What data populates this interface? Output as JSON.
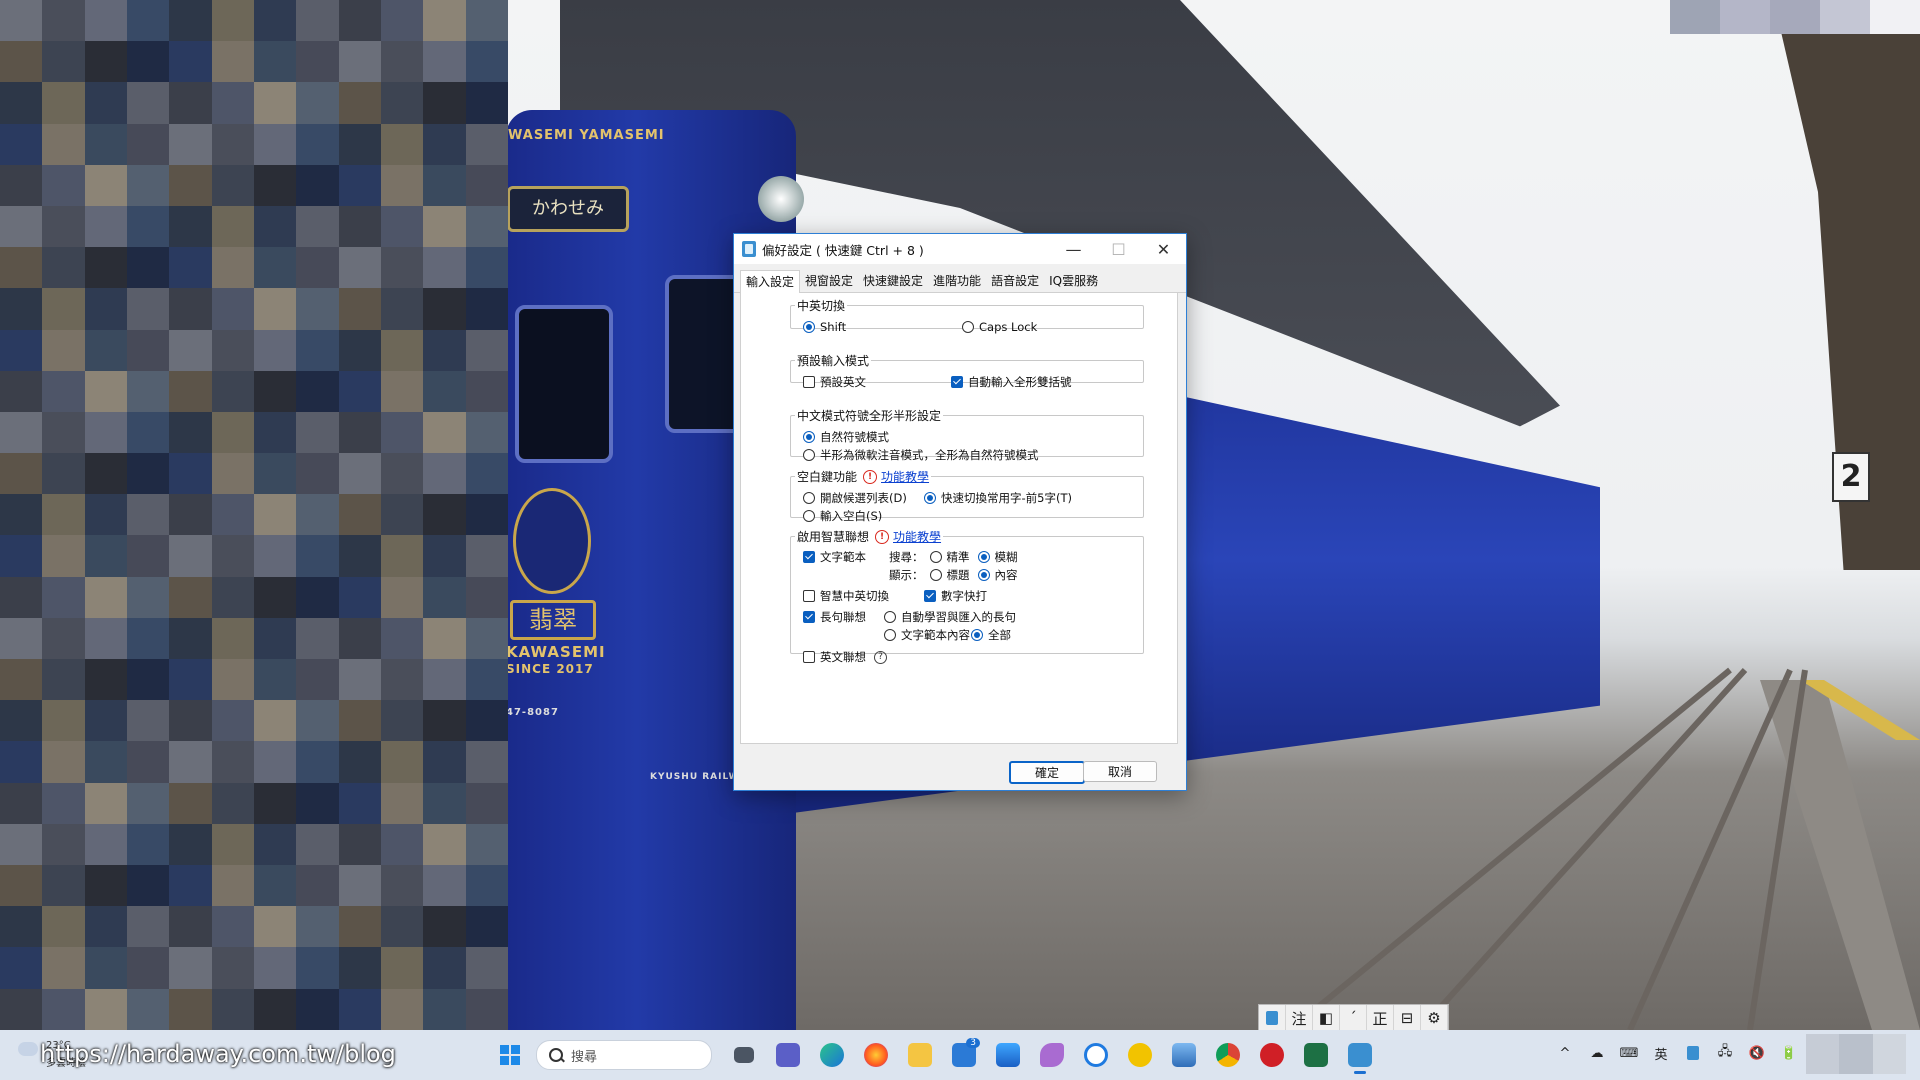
{
  "watermark": "https://hardaway.com.tw/blog",
  "wallpaper": {
    "destination_sign": "かわせみ",
    "train_name": "KAWASEMI",
    "train_name_cn": "翡翠",
    "since": "SINCE 2017",
    "car_number": "47-8087",
    "railway": "KYUSHU RAILWAY",
    "headboard": "WASEMI YAMASEMI",
    "platform_number": "2"
  },
  "dialog": {
    "title": "偏好設定 ( 快速鍵 Ctrl + 8 )",
    "controls": {
      "minimize": "—",
      "maximize": "☐",
      "close": "✕"
    },
    "tabs": [
      {
        "label": "輸入設定",
        "active": true
      },
      {
        "label": "視窗設定",
        "active": false
      },
      {
        "label": "快速鍵設定",
        "active": false
      },
      {
        "label": "進階功能",
        "active": false
      },
      {
        "label": "語音設定",
        "active": false
      },
      {
        "label": "IQ雲服務",
        "active": false
      }
    ],
    "groups": {
      "switch": {
        "legend": "中英切換",
        "options": [
          {
            "label": "Shift",
            "selected": true
          },
          {
            "label": "Caps Lock",
            "selected": false
          }
        ]
      },
      "default_mode": {
        "legend": "預設輸入模式",
        "options": [
          {
            "label": "預設英文",
            "checked": false
          },
          {
            "label": "自動輸入全形雙括號",
            "checked": true
          }
        ]
      },
      "symbol": {
        "legend": "中文模式符號全形半形設定",
        "options": [
          {
            "label": "自然符號模式",
            "selected": true
          },
          {
            "label": "半形為微軟注音模式，全形為自然符號模式",
            "selected": false
          }
        ]
      },
      "space": {
        "legend": "空白鍵功能",
        "link": "功能教學",
        "options": [
          {
            "label": "開啟候選列表(D)",
            "selected": false
          },
          {
            "label": "快速切換常用字-前5字(T)",
            "selected": true
          },
          {
            "label": "輸入空白(S)",
            "selected": false
          }
        ]
      },
      "smart": {
        "legend": "啟用智慧聯想",
        "link": "功能教學",
        "text_template": {
          "label": "文字範本",
          "checked": true
        },
        "search_label": "搜尋：",
        "search_options": [
          {
            "label": "精準",
            "selected": false
          },
          {
            "label": "模糊",
            "selected": true
          }
        ],
        "display_label": "顯示：",
        "display_options": [
          {
            "label": "標題",
            "selected": false
          },
          {
            "label": "內容",
            "selected": true
          }
        ],
        "smart_switch": {
          "label": "智慧中英切換",
          "checked": false
        },
        "quick_number": {
          "label": "數字快打",
          "checked": true
        },
        "long_sentence": {
          "label": "長句聯想",
          "checked": true
        },
        "long_options": [
          {
            "label": "自動學習與匯入的長句",
            "selected": false
          },
          {
            "label": "文字範本內容",
            "selected": false
          },
          {
            "label": "全部",
            "selected": true
          }
        ],
        "english_assoc": {
          "label": "英文聯想",
          "checked": false
        },
        "help_symbol": "?"
      }
    },
    "buttons": {
      "ok": "確定",
      "cancel": "取消"
    }
  },
  "ime_toolbar": [
    "注",
    "◧",
    "ˊ",
    "正",
    "⊟",
    "⚙"
  ],
  "taskbar": {
    "weather_temp": "23°C",
    "weather_desc": "多雲時陰",
    "search_placeholder": "搜尋",
    "mail_badge": "3",
    "tray_lang": "英",
    "tray_icons": [
      "^",
      "☁",
      "⌨",
      "英",
      "▣",
      "🖧",
      "🔇",
      "🔋"
    ]
  },
  "colors": {
    "accent": "#0a5fc0",
    "link": "#0b40d0",
    "warning": "#d9281e",
    "dialog_border": "#2d7fd6"
  }
}
